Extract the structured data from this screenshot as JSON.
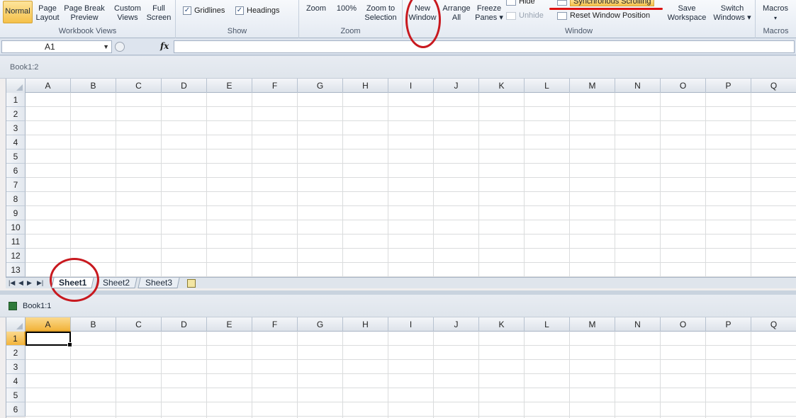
{
  "ribbon": {
    "workbook_views": {
      "label": "Workbook Views",
      "buttons": [
        {
          "l1": "Normal",
          "l2": ""
        },
        {
          "l1": "Page",
          "l2": "Layout"
        },
        {
          "l1": "Page Break",
          "l2": "Preview"
        },
        {
          "l1": "Custom",
          "l2": "Views"
        },
        {
          "l1": "Full",
          "l2": "Screen"
        }
      ]
    },
    "show": {
      "label": "Show",
      "gridlines": "Gridlines",
      "headings": "Headings",
      "check_mark": "✓"
    },
    "zoom": {
      "label": "Zoom",
      "zoom": "Zoom",
      "hundred": "100%",
      "zoom_to_l1": "Zoom to",
      "zoom_to_l2": "Selection"
    },
    "window": {
      "label": "Window",
      "new_l1": "New",
      "new_l2": "Window",
      "arrange_l1": "Arrange",
      "arrange_l2": "All",
      "freeze_l1": "Freeze",
      "freeze_l2": "Panes ▾",
      "hide": "Hide",
      "unhide": "Unhide",
      "sync": "Synchronous Scrolling",
      "reset": "Reset Window Position",
      "save_l1": "Save",
      "save_l2": "Workspace",
      "switch_l1": "Switch",
      "switch_l2": "Windows ▾"
    },
    "macros": {
      "label": "Macros",
      "btn": "Macros",
      "arrow": "▾"
    }
  },
  "formula_bar": {
    "name_box": "A1",
    "name_box_arrow": "▼",
    "fx": "fx"
  },
  "columns": [
    "A",
    "B",
    "C",
    "D",
    "E",
    "F",
    "G",
    "H",
    "I",
    "J",
    "K",
    "L",
    "M",
    "N",
    "O",
    "P",
    "Q"
  ],
  "window_top": {
    "title": "Book1:2",
    "rows": [
      "1",
      "2",
      "3",
      "4",
      "5",
      "6",
      "7",
      "8",
      "9",
      "10",
      "11",
      "12",
      "13"
    ],
    "tabs": [
      "Sheet1",
      "Sheet2",
      "Sheet3"
    ],
    "nav": [
      "|◀",
      "◀",
      "▶",
      "▶|"
    ]
  },
  "window_bottom": {
    "title": "Book1:1",
    "rows": [
      "1",
      "2",
      "3",
      "4",
      "5",
      "6"
    ],
    "selected_cell": "A1"
  }
}
